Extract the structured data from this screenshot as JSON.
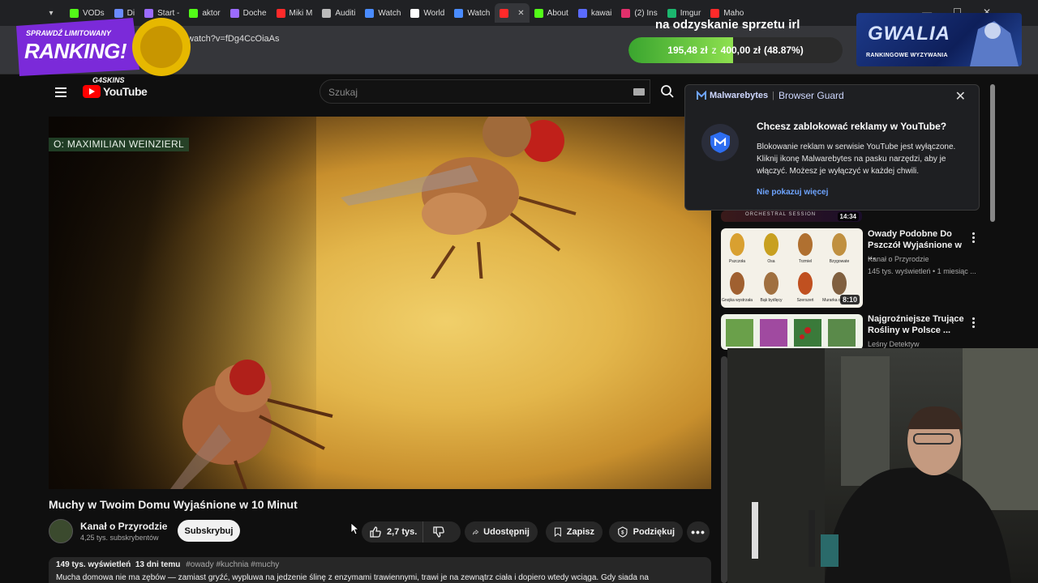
{
  "browser": {
    "tabs": [
      {
        "label": "VODs",
        "color": "#53fc18"
      },
      {
        "label": "Di",
        "color": "#6b8bff"
      },
      {
        "label": "Start -",
        "color": "#9b6bff"
      },
      {
        "label": "aktor",
        "color": "#53fc18"
      },
      {
        "label": "Doche",
        "color": "#9b6bff"
      },
      {
        "label": "Miki M",
        "color": "#ff2a2a"
      },
      {
        "label": "Auditi",
        "color": "#bbbbbb"
      },
      {
        "label": "Watch",
        "color": "#4a8cff"
      },
      {
        "label": "World",
        "color": "#ffffff"
      },
      {
        "label": "Watch",
        "color": "#4a8cff"
      },
      {
        "label": "",
        "color": "#ff2a2a",
        "active": true
      },
      {
        "label": "About",
        "color": "#53fc18"
      },
      {
        "label": "kawai",
        "color": "#5a6bff"
      },
      {
        "label": "(2) Ins",
        "color": "#e1306c"
      },
      {
        "label": "Imgur",
        "color": "#1bb76e"
      },
      {
        "label": "Maho",
        "color": "#ff2a2a"
      }
    ],
    "url": "/watch?v=fDg4CcOiaAs"
  },
  "youtube": {
    "logo_text": "YouTube",
    "search_placeholder": "Szukaj"
  },
  "video": {
    "credit_overlay": "O: MAXIMILIAN WEINZIERL",
    "title": "Muchy w Twoim Domu Wyjaśnione w 10 Minut",
    "channel_name": "Kanał o Przyrodzie",
    "channel_subs": "4,25 tys. subskrybentów",
    "subscribe_label": "Subskrybuj",
    "likes": "2,7 tys.",
    "share_label": "Udostępnij",
    "save_label": "Zapisz",
    "thanks_label": "Podziękuj",
    "views": "149 tys. wyświetleń",
    "age": "13 dni temu",
    "hashtags": "#owady #kuchnia #muchy",
    "description": "Mucha domowa nie ma zębów — zamiast gryźć, wypluwa na jedzenie ślinę z enzymami trawiennymi, trawi je na zewnątrz ciała i dopiero wtedy wciąga. Gdy siada na"
  },
  "recommendations": [
    {
      "title": "Owady Podobne Do Pszczół Wyjaśnione w ...",
      "channel": "Kanał o Przyrodzie",
      "meta": "145 tys. wyświetleń • 1 miesiąc ...",
      "duration": "8:10",
      "thumb_labels": [
        "Pszczoła",
        "Osa",
        "Trzmiel",
        "Bzygowate",
        "Gnojka wystrzała",
        "Bąk bydlęcy",
        "Szerszeń",
        "Murarka ogrodowa"
      ]
    },
    {
      "title": "Najgroźniejsze Trujące Rośliny w Polsce ...",
      "channel": "Leśny Detektyw",
      "meta": "",
      "duration": ""
    }
  ],
  "partial_rec_duration": "14:34",
  "partial_rec_text": "ORCHESTRAL SESSION",
  "malwarebytes": {
    "brand": "Malwarebytes",
    "product": "Browser Guard",
    "title": "Chcesz zablokować reklamy w YouTube?",
    "body": "Blokowanie reklam w serwisie YouTube jest wyłączone. Kliknij ikonę Malwarebytes na pasku narzędzi, aby je włączyć. Możesz je wyłączyć w każdej chwili.",
    "link": "Nie pokazuj więcej"
  },
  "overlays": {
    "promo_line1": "SPRAWDŹ LIMITOWANY",
    "promo_line2": "RANKING!",
    "promo_brand": "G4SKINS",
    "donation_title": "na odzyskanie sprzetu irl",
    "donation_current": "195,48 zł",
    "donation_separator": "z",
    "donation_goal": "400,00 zł",
    "donation_percent_label": "(48.87%)",
    "donation_progress": 0.4887,
    "gwalia_title": "GWALIA",
    "gwalia_sub": "RANKINGOWE WYZYWANIA"
  },
  "colors": {
    "yt_red": "#ff0000",
    "mb_link": "#6ea4ff",
    "progress_green": "#6cc93c"
  }
}
